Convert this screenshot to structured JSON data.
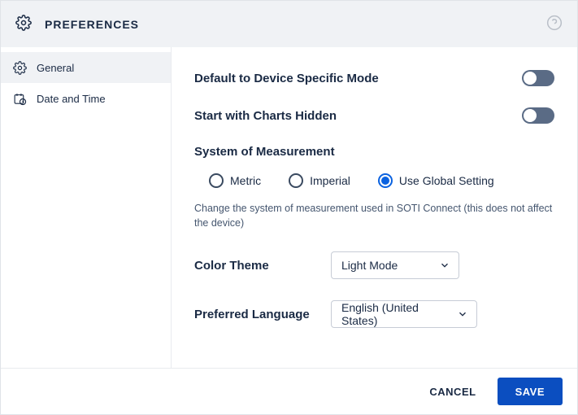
{
  "header": {
    "title": "PREFERENCES"
  },
  "sidebar": {
    "items": [
      {
        "label": "General"
      },
      {
        "label": "Date and Time"
      }
    ]
  },
  "main": {
    "default_mode_label": "Default to Device Specific Mode",
    "charts_hidden_label": "Start with Charts Hidden",
    "measurement_section": "System of Measurement",
    "measurement_options": {
      "metric": "Metric",
      "imperial": "Imperial",
      "global": "Use Global Setting"
    },
    "measurement_help": "Change the system of measurement used in SOTI Connect (this does not affect the device)",
    "color_theme_label": "Color Theme",
    "color_theme_value": "Light Mode",
    "language_label": "Preferred Language",
    "language_value": "English (United States)"
  },
  "footer": {
    "cancel": "CANCEL",
    "save": "SAVE"
  }
}
